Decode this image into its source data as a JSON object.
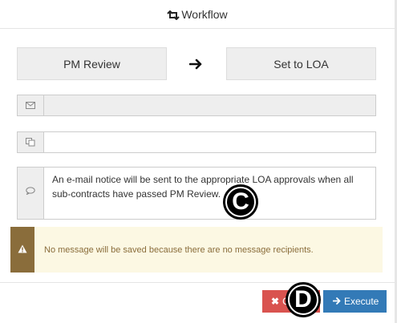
{
  "header": {
    "title": "Workflow",
    "icon": "retweet-icon"
  },
  "workflow": {
    "from_step": "PM Review",
    "to_step": "Set to LOA",
    "arrow_icon": "arrow-right-icon"
  },
  "form": {
    "to_field": {
      "icon": "envelope-icon",
      "value": ""
    },
    "cc_field": {
      "icon": "copy-icon",
      "value": ""
    },
    "message_field": {
      "icon": "comment-icon",
      "value": "An e-mail notice will be sent to the appropriate LOA approvals when all sub-contracts have passed PM Review."
    }
  },
  "warning": {
    "icon": "warning-icon",
    "text": "No message will be saved because there are no message recipients.",
    "colors": {
      "background": "#fcf8e3",
      "stripe": "#8a6d3b"
    }
  },
  "footer": {
    "cancel_label": "C",
    "execute_label": "Execute",
    "colors": {
      "cancel": "#d9534f",
      "execute": "#337ab7"
    }
  },
  "markers": {
    "c": "C",
    "d": "D"
  }
}
